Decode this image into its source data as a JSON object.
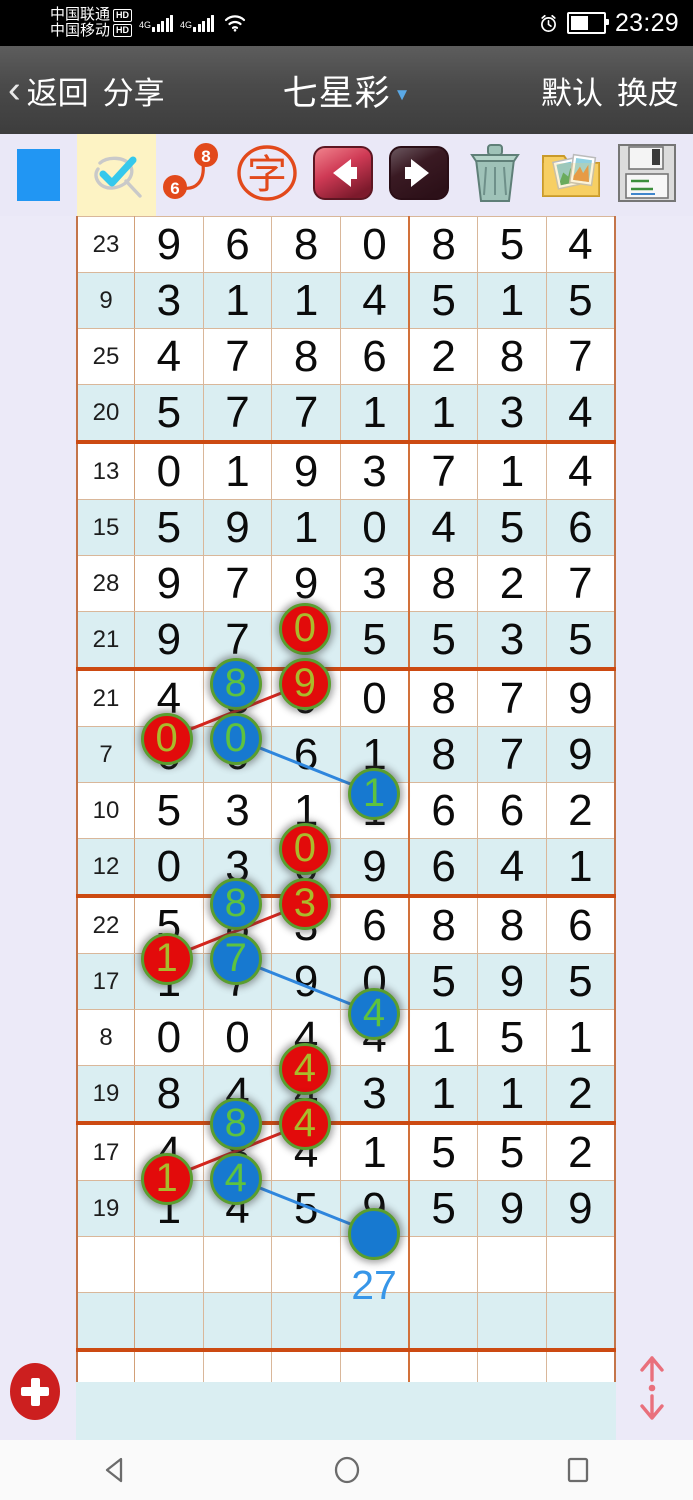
{
  "status_bar": {
    "carrier_1": "中国联通",
    "carrier_1_badge": "HD",
    "carrier_2": "中国移动",
    "carrier_2_badge": "HD",
    "network_1": "4G",
    "network_2": "4G",
    "wifi_icon": "wifi-icon",
    "alarm_icon": "alarm-clock-icon",
    "battery_icon": "battery-icon",
    "time": "23:29"
  },
  "title_bar": {
    "back_label": "返回",
    "share_label": "分享",
    "title": "七星彩",
    "dropdown_icon": "chevron-down-icon",
    "right_label_1": "默认",
    "right_label_2": "换皮"
  },
  "toolbar": {
    "items": [
      {
        "name": "color-swatch",
        "icon": "blue-square-icon",
        "label": ""
      },
      {
        "name": "pen-tool",
        "icon": "check-pen-icon",
        "label": "",
        "active": true
      },
      {
        "name": "connector-tool",
        "icon": "connector-6-8-icon",
        "label_from": "6",
        "label_to": "8"
      },
      {
        "name": "text-tool",
        "icon": "zi-stamp-icon",
        "label": "字"
      },
      {
        "name": "previous-button",
        "icon": "arrow-left-icon",
        "label": ""
      },
      {
        "name": "next-button",
        "icon": "arrow-right-icon",
        "label": ""
      },
      {
        "name": "delete-button",
        "icon": "trash-can-icon",
        "label": ""
      },
      {
        "name": "gallery-button",
        "icon": "folder-photos-icon",
        "label": ""
      },
      {
        "name": "save-button",
        "icon": "floppy-disk-icon",
        "label": ""
      }
    ]
  },
  "grid": {
    "accent_color": "#cc4a12",
    "marker_red": "#e20b0b",
    "marker_blue": "#1779d0",
    "marker_ring": "#5a9e2f",
    "sum_color": "#3796e8",
    "rows": [
      {
        "index": "23",
        "digits": [
          "9",
          "6",
          "8",
          "0",
          "8",
          "5",
          "4"
        ]
      },
      {
        "index": "9",
        "digits": [
          "3",
          "1",
          "1",
          "4",
          "5",
          "1",
          "5"
        ]
      },
      {
        "index": "25",
        "digits": [
          "4",
          "7",
          "8",
          "6",
          "2",
          "8",
          "7"
        ]
      },
      {
        "index": "20",
        "digits": [
          "5",
          "7",
          "7",
          "1",
          "1",
          "3",
          "4"
        ]
      },
      {
        "index": "13",
        "digits": [
          "0",
          "1",
          "9",
          "3",
          "7",
          "1",
          "4"
        ]
      },
      {
        "index": "15",
        "digits": [
          "5",
          "9",
          "1",
          "0",
          "4",
          "5",
          "6"
        ]
      },
      {
        "index": "28",
        "digits": [
          "9",
          "7",
          "9",
          "3",
          "8",
          "2",
          "7"
        ]
      },
      {
        "index": "21",
        "digits": [
          "9",
          "7",
          "0",
          "5",
          "5",
          "3",
          "5"
        ]
      },
      {
        "index": "21",
        "digits": [
          "4",
          "8",
          "9",
          "0",
          "8",
          "7",
          "9"
        ]
      },
      {
        "index": "7",
        "digits": [
          "0",
          "0",
          "6",
          "1",
          "8",
          "7",
          "9"
        ]
      },
      {
        "index": "10",
        "digits": [
          "5",
          "3",
          "1",
          "1",
          "6",
          "6",
          "2"
        ]
      },
      {
        "index": "12",
        "digits": [
          "0",
          "3",
          "0",
          "9",
          "6",
          "4",
          "1"
        ]
      },
      {
        "index": "22",
        "digits": [
          "5",
          "8",
          "3",
          "6",
          "8",
          "8",
          "6"
        ]
      },
      {
        "index": "17",
        "digits": [
          "1",
          "7",
          "9",
          "0",
          "5",
          "9",
          "5"
        ]
      },
      {
        "index": "8",
        "digits": [
          "0",
          "0",
          "4",
          "4",
          "1",
          "5",
          "1"
        ]
      },
      {
        "index": "19",
        "digits": [
          "8",
          "4",
          "4",
          "3",
          "1",
          "1",
          "2"
        ]
      },
      {
        "index": "17",
        "digits": [
          "4",
          "8",
          "4",
          "1",
          "5",
          "5",
          "2"
        ]
      },
      {
        "index": "19",
        "digits": [
          "1",
          "4",
          "5",
          "9",
          "5",
          "9",
          "9"
        ]
      },
      {
        "index": "",
        "digits": [
          "",
          "",
          "",
          "",
          "",
          "",
          ""
        ]
      },
      {
        "index": "",
        "digits": [
          "",
          "",
          "",
          "",
          "",
          "",
          ""
        ]
      },
      {
        "index": "",
        "digits": [
          "",
          "",
          "",
          "",
          "",
          "",
          ""
        ]
      }
    ],
    "group_breaks": [
      3,
      7,
      11,
      15,
      19
    ],
    "markers": [
      {
        "row": 7,
        "col": 3,
        "value": "0",
        "type": "red"
      },
      {
        "row": 8,
        "col": 2,
        "value": "8",
        "type": "blue"
      },
      {
        "row": 8,
        "col": 3,
        "value": "9",
        "type": "red"
      },
      {
        "row": 9,
        "col": 1,
        "value": "0",
        "type": "red"
      },
      {
        "row": 9,
        "col": 2,
        "value": "0",
        "type": "blue"
      },
      {
        "row": 10,
        "col": 4,
        "value": "1",
        "type": "blue"
      },
      {
        "row": 11,
        "col": 3,
        "value": "0",
        "type": "red"
      },
      {
        "row": 12,
        "col": 2,
        "value": "8",
        "type": "blue"
      },
      {
        "row": 12,
        "col": 3,
        "value": "3",
        "type": "red"
      },
      {
        "row": 13,
        "col": 1,
        "value": "1",
        "type": "red"
      },
      {
        "row": 13,
        "col": 2,
        "value": "7",
        "type": "blue"
      },
      {
        "row": 14,
        "col": 4,
        "value": "4",
        "type": "blue"
      },
      {
        "row": 15,
        "col": 3,
        "value": "4",
        "type": "red"
      },
      {
        "row": 16,
        "col": 2,
        "value": "8",
        "type": "blue"
      },
      {
        "row": 16,
        "col": 3,
        "value": "4",
        "type": "red"
      },
      {
        "row": 17,
        "col": 1,
        "value": "1",
        "type": "red"
      },
      {
        "row": 17,
        "col": 2,
        "value": "4",
        "type": "blue"
      },
      {
        "row": 18,
        "col": 4,
        "value": "",
        "type": "plain"
      }
    ],
    "links": [
      {
        "from": {
          "row": 9,
          "col": 1
        },
        "to": {
          "row": 8,
          "col": 3
        },
        "color": "red"
      },
      {
        "from": {
          "row": 9,
          "col": 2
        },
        "to": {
          "row": 10,
          "col": 4
        },
        "color": "blue"
      },
      {
        "from": {
          "row": 13,
          "col": 1
        },
        "to": {
          "row": 12,
          "col": 3
        },
        "color": "red"
      },
      {
        "from": {
          "row": 13,
          "col": 2
        },
        "to": {
          "row": 14,
          "col": 4
        },
        "color": "blue"
      },
      {
        "from": {
          "row": 17,
          "col": 1
        },
        "to": {
          "row": 16,
          "col": 3
        },
        "color": "red"
      },
      {
        "from": {
          "row": 17,
          "col": 2
        },
        "to": {
          "row": 18,
          "col": 4
        },
        "color": "blue"
      }
    ],
    "sum_cell": {
      "row": 19,
      "col": 4,
      "value": "27"
    }
  },
  "footer": {
    "add_button_icon": "plus-icon",
    "scroll_toggle_icon": "up-down-arrows-icon"
  },
  "navbar": {
    "back_icon": "triangle-back-icon",
    "home_icon": "circle-home-icon",
    "recents_icon": "square-recents-icon"
  }
}
